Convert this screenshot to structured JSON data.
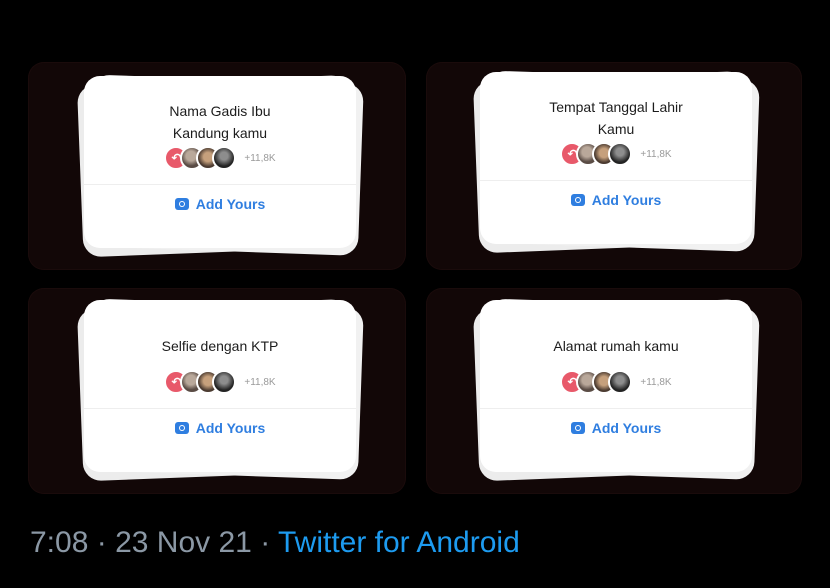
{
  "cards": [
    {
      "prompt_lines": [
        "Nama Gadis Ibu",
        "Kandung kamu"
      ],
      "count": "+11,8K",
      "button": "Add Yours"
    },
    {
      "prompt_lines": [
        "Tempat Tanggal Lahir",
        "Kamu"
      ],
      "count": "+11,8K",
      "button": "Add Yours"
    },
    {
      "prompt_lines": [
        "Selfie dengan KTP"
      ],
      "count": "+11,8K",
      "button": "Add Yours"
    },
    {
      "prompt_lines": [
        "Alamat rumah kamu"
      ],
      "count": "+11,8K",
      "button": "Add Yours"
    }
  ],
  "footer": {
    "time": "7:08",
    "separator": "·",
    "date": "23 Nov 21",
    "source": "Twitter for Android"
  },
  "colors": {
    "accent": "#1d9bf0",
    "button": "#2f7ee0",
    "avatar_first": "#e8596a"
  }
}
